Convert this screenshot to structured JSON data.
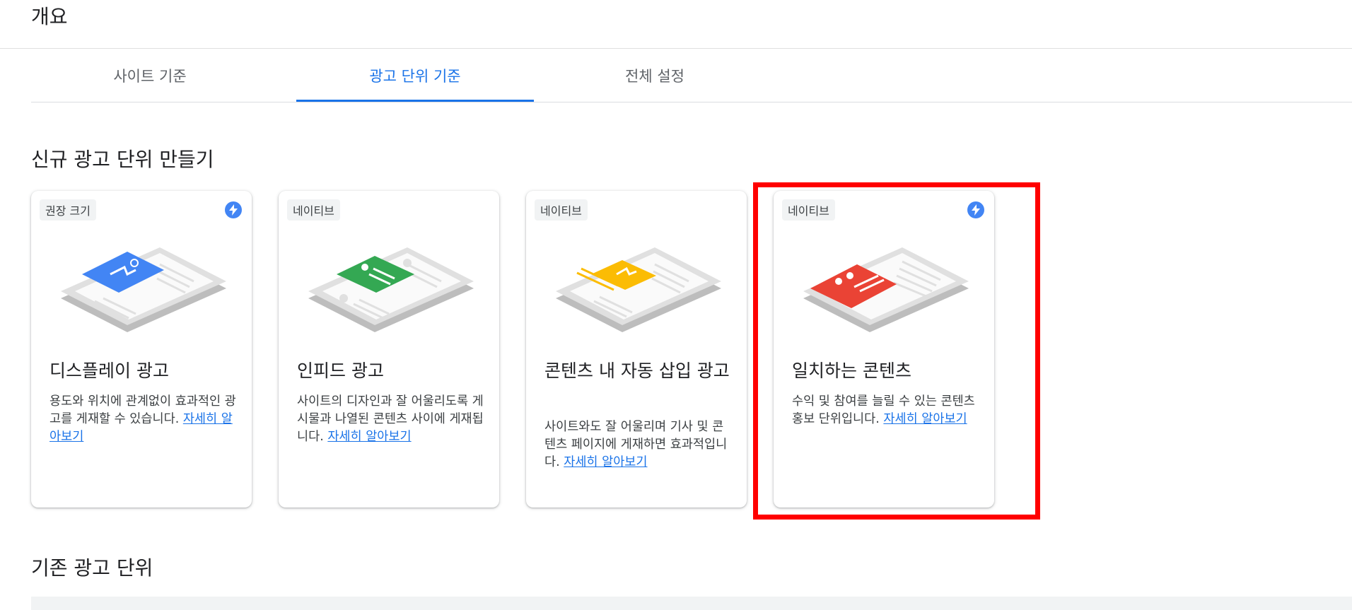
{
  "page": {
    "title": "개요"
  },
  "tabs": [
    {
      "label": "사이트 기준",
      "active": false
    },
    {
      "label": "광고 단위 기준",
      "active": true
    },
    {
      "label": "전체 설정",
      "active": false
    }
  ],
  "create_section": {
    "title": "신규 광고 단위 만들기"
  },
  "cards": [
    {
      "chip": "권장 크기",
      "bolt": true,
      "accent": "#4285f4",
      "title": "디스플레이 광고",
      "desc": "용도와 위치에 관계없이 효과적인 광고를 게재할 수 있습니다. ",
      "link": "자세히 알아보기"
    },
    {
      "chip": "네이티브",
      "bolt": false,
      "accent": "#34a853",
      "title": "인피드 광고",
      "desc": "사이트의 디자인과 잘 어울리도록 게시물과 나열된 콘텐츠 사이에 게재됩니다. ",
      "link": "자세히 알아보기"
    },
    {
      "chip": "네이티브",
      "bolt": false,
      "accent": "#fbbc04",
      "title": "콘텐츠 내 자동 삽입 광고",
      "desc": "사이트와도 잘 어울리며 기사 및 콘텐츠 페이지에 게재하면 효과적입니다. ",
      "link": "자세히 알아보기"
    },
    {
      "chip": "네이티브",
      "bolt": true,
      "accent": "#ea4335",
      "title": "일치하는 콘텐츠",
      "desc": "수익 및 참여를 늘릴 수 있는 콘텐츠 홍보 단위입니다. ",
      "link": "자세히 알아보기"
    }
  ],
  "existing_section": {
    "title": "기존 광고 단위"
  },
  "colors": {
    "accent": "#1a73e8",
    "highlight": "#ff0000"
  },
  "icons": {
    "bolt": "lightning-bolt-icon"
  }
}
